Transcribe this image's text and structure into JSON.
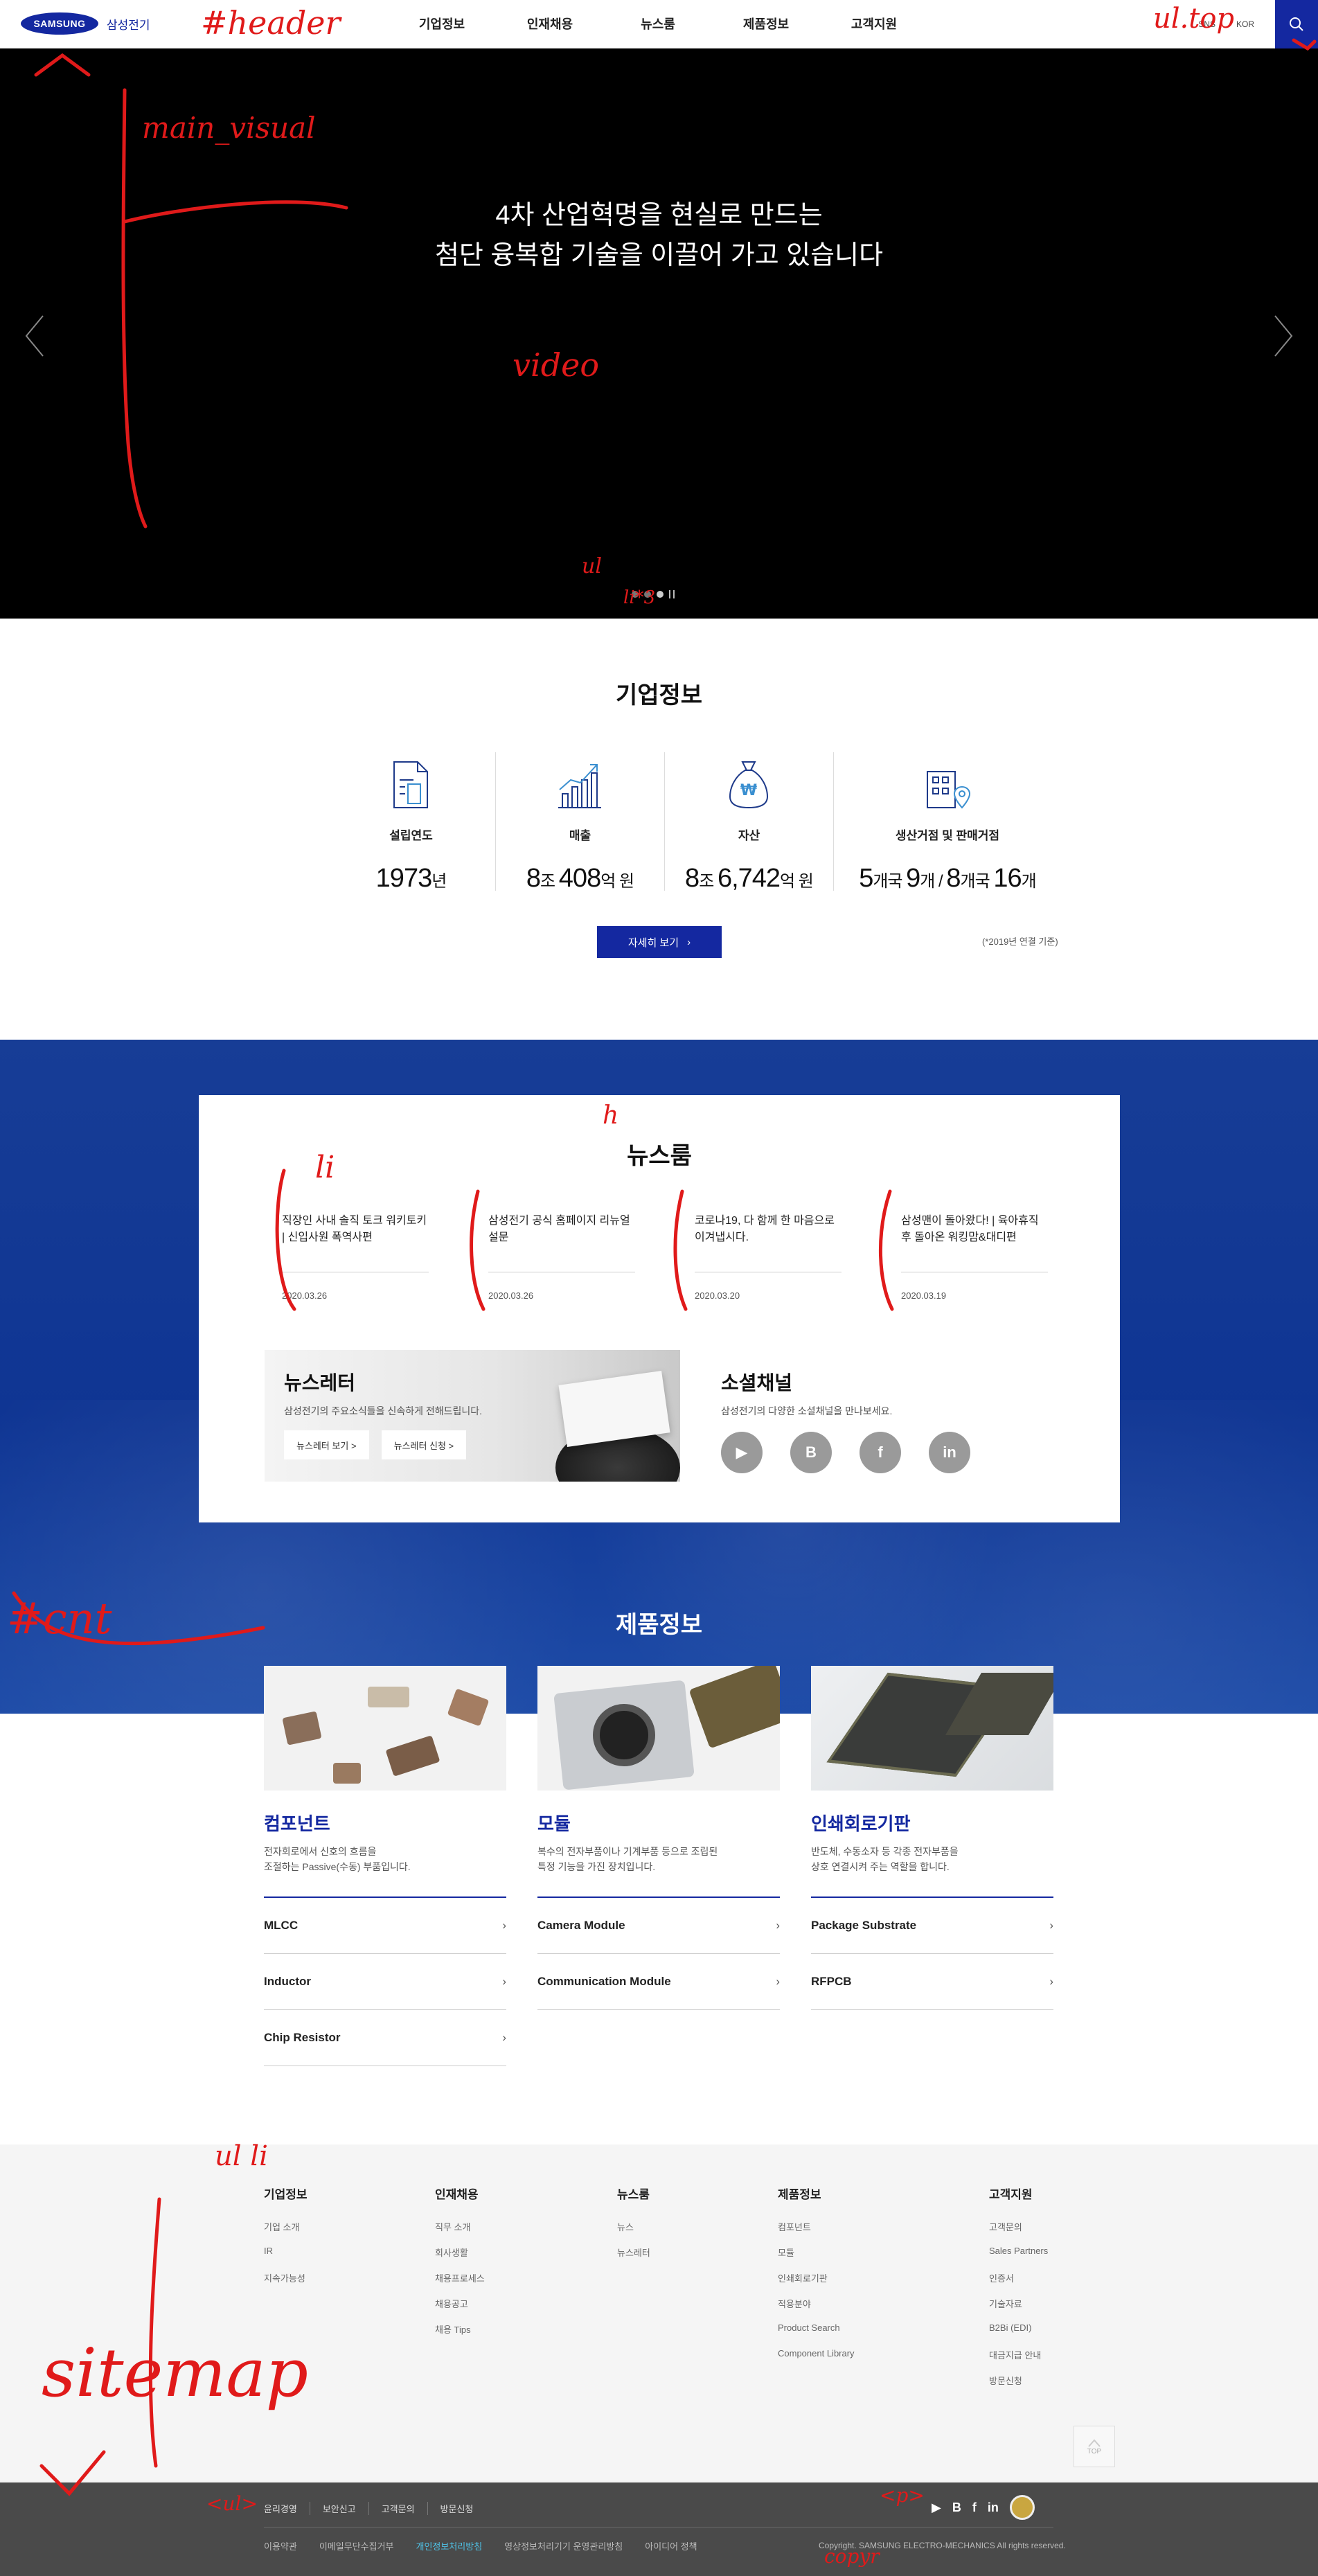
{
  "header": {
    "logo_text": "SAMSUNG",
    "logo_ko": "삼성전기",
    "nav": [
      "기업정보",
      "인재채용",
      "뉴스룸",
      "제품정보",
      "고객지원"
    ],
    "util_sns": "SNS",
    "util_lang": "KOR",
    "search_icon": "search-icon"
  },
  "visual": {
    "headline_line1": "4차 산업혁명을 현실로 만드는",
    "headline_line2": "첨단 융복합 기술을 이끌어 가고 있습니다"
  },
  "company": {
    "title": "기업정보",
    "stats": [
      {
        "label": "설립연도",
        "num1": "1973",
        "unit1": "년"
      },
      {
        "label": "매출",
        "num1": "8",
        "unit1": "조 ",
        "num2": "408",
        "unit2": "억 원"
      },
      {
        "label": "자산",
        "num1": "8",
        "unit1": "조 ",
        "num2": "6,742",
        "unit2": "억 원"
      },
      {
        "label": "생산거점 및 판매거점",
        "num1": "5",
        "unit1": "개국 ",
        "num2": "9",
        "unit2": "개 / ",
        "num3": "8",
        "unit3": "개국 ",
        "num4": "16",
        "unit4": "개"
      }
    ],
    "detail_button": "자세히 보기",
    "note": "(*2019년 연결 기준)"
  },
  "newsroom": {
    "title": "뉴스룸",
    "items": [
      {
        "title": "직장인 사내 솔직 토크 워키토키 | 신입사원 폭역사편",
        "date": "2020.03.26"
      },
      {
        "title": "삼성전기 공식 홈페이지 리뉴얼 설문",
        "date": "2020.03.26"
      },
      {
        "title": "코로나19, 다 함께 한 마음으로 이겨냅시다.",
        "date": "2020.03.20"
      },
      {
        "title": "삼성맨이 돌아왔다! | 육아휴직 후 돌아온 워킹맘&대디편",
        "date": "2020.03.19"
      }
    ],
    "newsletter": {
      "title": "뉴스레터",
      "desc": "삼성전기의 주요소식들을 신속하게 전해드립니다.",
      "btn_view": "뉴스레터 보기 >",
      "btn_sub": "뉴스레터 신청 >"
    },
    "social": {
      "title": "소셜채널",
      "desc": "삼성전기의 다양한 소셜채널을 만나보세요.",
      "icons": [
        "youtube-icon",
        "blog-icon",
        "facebook-icon",
        "linkedin-icon"
      ],
      "glyphs": [
        "▶",
        "B",
        "f",
        "in"
      ]
    }
  },
  "products": {
    "title": "제품정보",
    "items": [
      {
        "name": "컴포넌트",
        "desc1": "전자회로에서 신호의 흐름을",
        "desc2": "조절하는 Passive(수동) 부품입니다.",
        "links": [
          "MLCC",
          "Inductor",
          "Chip Resistor"
        ]
      },
      {
        "name": "모듈",
        "desc1": "복수의 전자부품이나 기계부품 등으로 조립된",
        "desc2": "특정 기능을 가진 장치입니다.",
        "links": [
          "Camera Module",
          "Communication Module"
        ]
      },
      {
        "name": "인쇄회로기판",
        "desc1": "반도체, 수동소자 등 각종 전자부품을",
        "desc2": "상호 연결시켜 주는 역할을 합니다.",
        "links": [
          "Package Substrate",
          "RFPCB"
        ]
      }
    ]
  },
  "sitemap": {
    "cols": [
      {
        "title": "기업정보",
        "items": [
          "기업 소개",
          "IR",
          "지속가능성"
        ]
      },
      {
        "title": "인재채용",
        "items": [
          "직무 소개",
          "회사생활",
          "채용프로세스",
          "채용공고",
          "채용 Tips"
        ]
      },
      {
        "title": "뉴스룸",
        "items": [
          "뉴스",
          "뉴스레터"
        ]
      },
      {
        "title": "제품정보",
        "items": [
          "컴포넌트",
          "모듈",
          "인쇄회로기판",
          "적용분야",
          "Product Search",
          "Component Library"
        ]
      },
      {
        "title": "고객지원",
        "items": [
          "고객문의",
          "Sales Partners",
          "인증서",
          "기술자료",
          "B2Bi (EDI)",
          "대금지급 안내",
          "방문신청"
        ]
      }
    ],
    "top_label": "TOP"
  },
  "footer": {
    "row1": [
      "윤리경영",
      "보안신고",
      "고객문의",
      "방문신청"
    ],
    "row2": [
      "이용약관",
      "이메일무단수집거부",
      "개인정보처리방침",
      "영상정보처리기기 운영관리방침",
      "아이디어 정책"
    ],
    "sns_glyphs": [
      "▶",
      "B",
      "f",
      "in"
    ],
    "copyright": "Copyright. SAMSUNG ELECTRO-MECHANICS All rights reserved."
  },
  "annotations": [
    "#header",
    "main_visual",
    "video",
    "ul",
    "li*3",
    "ul.top",
    "#cnt",
    "h",
    "li",
    "ul li",
    "sitemap",
    "<ul>",
    "<p>",
    "copyr"
  ]
}
